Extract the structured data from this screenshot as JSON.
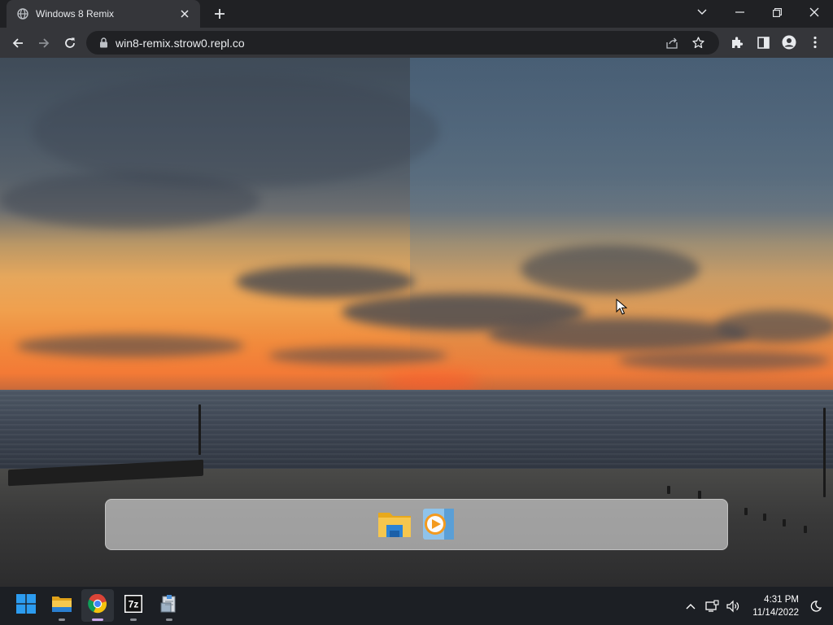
{
  "browser": {
    "tab_title": "Windows 8 Remix",
    "url": "win8-remix.strow0.repl.co"
  },
  "taskbar": {
    "time": "4:31 PM",
    "date": "11/14/2022",
    "apps": [
      "start",
      "file-explorer",
      "chrome",
      "7zip",
      "installer"
    ]
  },
  "dock": {
    "items": [
      "file-explorer",
      "media-player"
    ]
  },
  "colors": {
    "chrome_dark": "#202124",
    "chrome_toolbar": "#35363a",
    "taskbar": "#1c1f24",
    "windows_blue": "#2c9cf0"
  }
}
